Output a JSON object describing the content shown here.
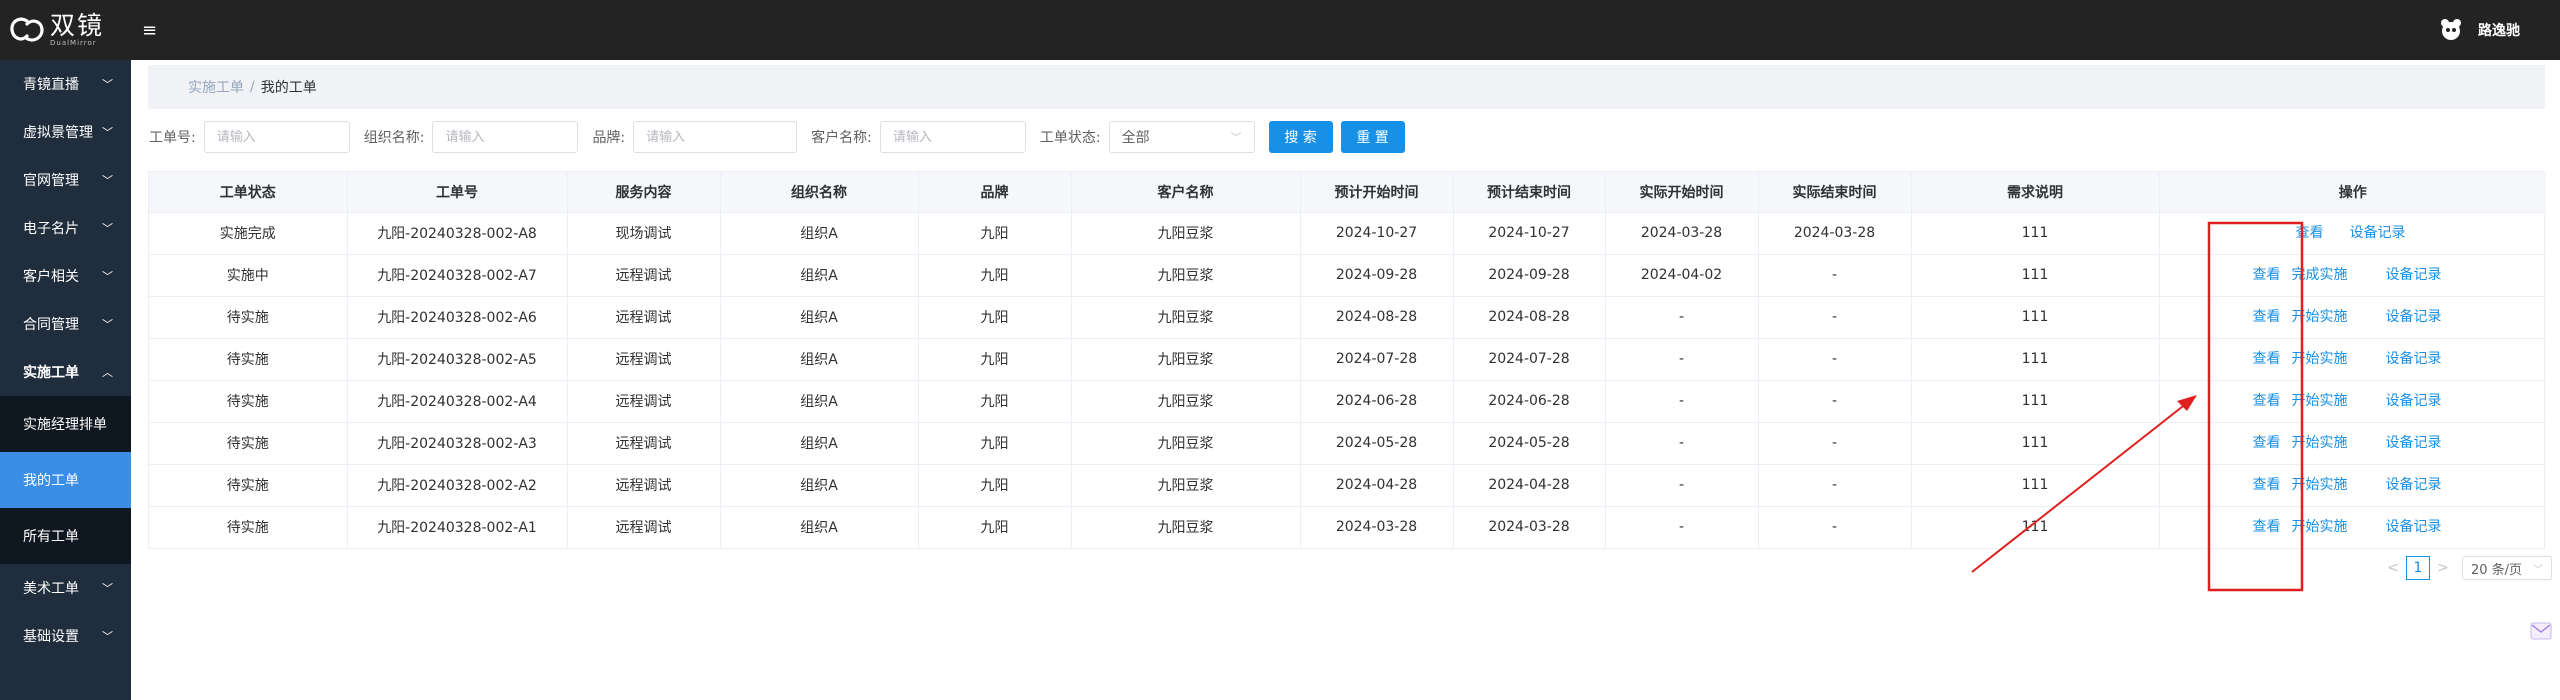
{
  "app": {
    "logo_text": "双镜",
    "logo_sub": "DualMirror",
    "menu_toggle": "≡",
    "user_name": "路逸驰"
  },
  "sidebar": {
    "items": [
      {
        "label": "青镜直播",
        "chevron": "﹀"
      },
      {
        "label": "虚拟景管理",
        "chevron": "﹀"
      },
      {
        "label": "官网管理",
        "chevron": "﹀"
      },
      {
        "label": "电子名片",
        "chevron": "﹀"
      },
      {
        "label": "客户相关",
        "chevron": "﹀"
      },
      {
        "label": "合同管理",
        "chevron": "﹀"
      },
      {
        "label": "实施工单",
        "chevron": "︿"
      },
      {
        "label": "实施经理排单"
      },
      {
        "label": "我的工单"
      },
      {
        "label": "所有工单"
      },
      {
        "label": "美术工单",
        "chevron": "﹀"
      },
      {
        "label": "基础设置",
        "chevron": "﹀"
      }
    ]
  },
  "breadcrumb": {
    "parent": "实施工单",
    "separator": "/",
    "current": "我的工单"
  },
  "filters": {
    "order_no_label": "工单号:",
    "org_label": "组织名称:",
    "brand_label": "品牌:",
    "customer_label": "客户名称:",
    "status_label": "工单状态:",
    "placeholder": "请输入",
    "status_value": "全部",
    "search_button": "搜 索",
    "reset_button": "重 置"
  },
  "table": {
    "columns": [
      "工单状态",
      "工单号",
      "服务内容",
      "组织名称",
      "品牌",
      "客户名称",
      "预计开始时间",
      "预计结束时间",
      "实际开始时间",
      "实际结束时间",
      "需求说明",
      "操作"
    ],
    "rows": [
      {
        "cells": [
          "实施完成",
          "九阳-20240328-002-A8",
          "现场调试",
          "组织A",
          "九阳",
          "九阳豆浆",
          "2024-10-27",
          "2024-10-27",
          "2024-03-28",
          "2024-03-28",
          "111"
        ],
        "actions": [
          "查看",
          "设备记录"
        ]
      },
      {
        "cells": [
          "实施中",
          "九阳-20240328-002-A7",
          "远程调试",
          "组织A",
          "九阳",
          "九阳豆浆",
          "2024-09-28",
          "2024-09-28",
          "2024-04-02",
          "-",
          "111"
        ],
        "actions": [
          "查看",
          "完成实施",
          "设备记录"
        ]
      },
      {
        "cells": [
          "待实施",
          "九阳-20240328-002-A6",
          "远程调试",
          "组织A",
          "九阳",
          "九阳豆浆",
          "2024-08-28",
          "2024-08-28",
          "-",
          "-",
          "111"
        ],
        "actions": [
          "查看",
          "开始实施",
          "设备记录"
        ]
      },
      {
        "cells": [
          "待实施",
          "九阳-20240328-002-A5",
          "远程调试",
          "组织A",
          "九阳",
          "九阳豆浆",
          "2024-07-28",
          "2024-07-28",
          "-",
          "-",
          "111"
        ],
        "actions": [
          "查看",
          "开始实施",
          "设备记录"
        ]
      },
      {
        "cells": [
          "待实施",
          "九阳-20240328-002-A4",
          "远程调试",
          "组织A",
          "九阳",
          "九阳豆浆",
          "2024-06-28",
          "2024-06-28",
          "-",
          "-",
          "111"
        ],
        "actions": [
          "查看",
          "开始实施",
          "设备记录"
        ]
      },
      {
        "cells": [
          "待实施",
          "九阳-20240328-002-A3",
          "远程调试",
          "组织A",
          "九阳",
          "九阳豆浆",
          "2024-05-28",
          "2024-05-28",
          "-",
          "-",
          "111"
        ],
        "actions": [
          "查看",
          "开始实施",
          "设备记录"
        ]
      },
      {
        "cells": [
          "待实施",
          "九阳-20240328-002-A2",
          "远程调试",
          "组织A",
          "九阳",
          "九阳豆浆",
          "2024-04-28",
          "2024-04-28",
          "-",
          "-",
          "111"
        ],
        "actions": [
          "查看",
          "开始实施",
          "设备记录"
        ]
      },
      {
        "cells": [
          "待实施",
          "九阳-20240328-002-A1",
          "远程调试",
          "组织A",
          "九阳",
          "九阳豆浆",
          "2024-03-28",
          "2024-03-28",
          "-",
          "-",
          "111"
        ],
        "actions": [
          "查看",
          "开始实施",
          "设备记录"
        ]
      }
    ]
  },
  "pagination": {
    "prev": "<",
    "current_page": "1",
    "next": ">",
    "page_size": "20 条/页"
  },
  "colors": {
    "header_bg": "#232323",
    "sidebar_bg": "#1f2d3d",
    "submenu_bg": "#0f1720",
    "active_bg": "#3a8ee6",
    "primary": "#1890e6",
    "annotation": "#e02020"
  }
}
